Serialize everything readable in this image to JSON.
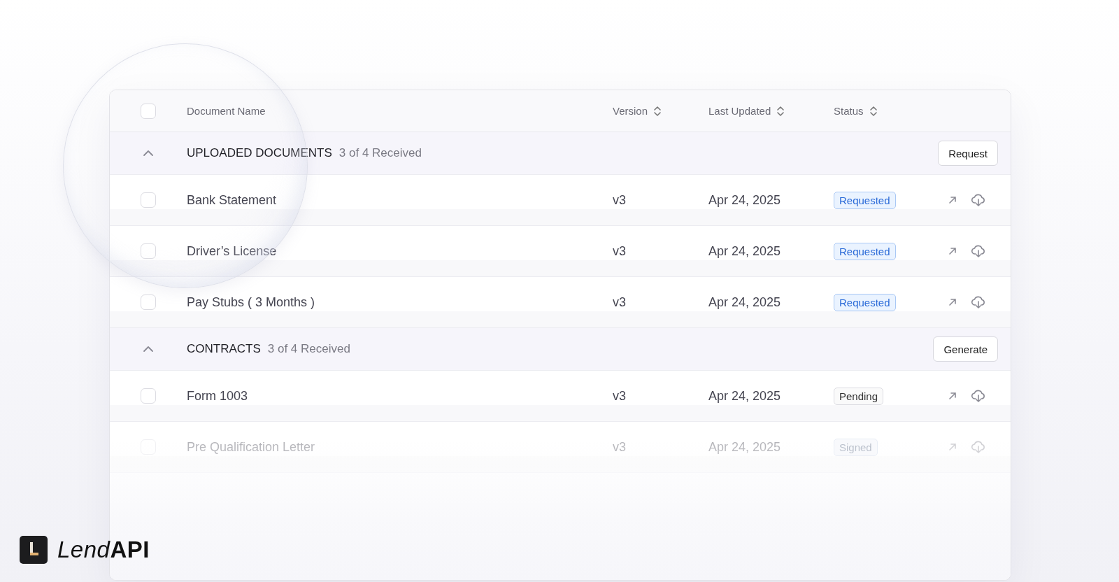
{
  "table": {
    "header": {
      "checked": false,
      "columns": [
        {
          "label": "Document Name",
          "sortable": false
        },
        {
          "label": "Version",
          "sortable": true
        },
        {
          "label": "Last Updated",
          "sortable": true
        },
        {
          "label": "Status",
          "sortable": true
        }
      ]
    },
    "sections": [
      {
        "title": "UPLOADED DOCUMENTS",
        "count": "3 of 4 Received",
        "expanded": true,
        "action": "Request",
        "rows": [
          {
            "name": "Bank Statement",
            "version": "v3",
            "updated": "Apr 24, 2025",
            "status": "Requested",
            "kind": "requested",
            "checked": false,
            "faded": false
          },
          {
            "name": "Driver’s License",
            "version": "v3",
            "updated": "Apr 24, 2025",
            "status": "Requested",
            "kind": "requested",
            "checked": false,
            "faded": false
          },
          {
            "name": "Pay Stubs ( 3 Months )",
            "version": "v3",
            "updated": "Apr 24, 2025",
            "status": "Requested",
            "kind": "requested",
            "checked": false,
            "faded": false
          }
        ]
      },
      {
        "title": "CONTRACTS",
        "count": "3 of 4 Received",
        "expanded": true,
        "action": "Generate",
        "rows": [
          {
            "name": "Form 1003",
            "version": "v3",
            "updated": "Apr 24, 2025",
            "status": "Pending",
            "kind": "pending",
            "checked": false,
            "faded": false
          },
          {
            "name": "Pre Qualification Letter",
            "version": "v3",
            "updated": "Apr 24, 2025",
            "status": "Signed",
            "kind": "signed",
            "checked": false,
            "faded": true
          }
        ]
      }
    ]
  },
  "brand": {
    "name_light": "Lend",
    "name_bold": "API"
  }
}
